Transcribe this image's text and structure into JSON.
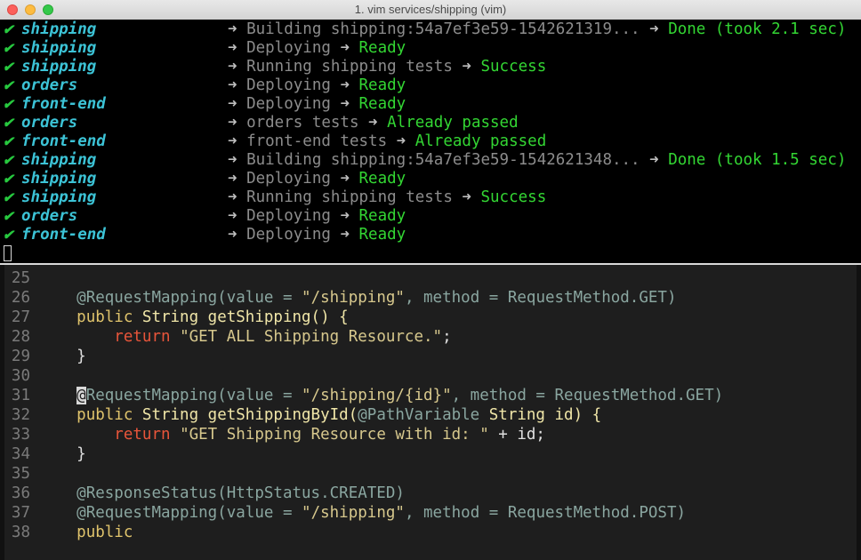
{
  "window": {
    "title": "1. vim services/shipping (vim)"
  },
  "log": {
    "check_glyph": "✔",
    "arrow_glyph": "➜",
    "lines": [
      {
        "service": "shipping",
        "action": "Building shipping:54a7ef3e59-1542621319...",
        "status": "Done (took 2.1 sec)"
      },
      {
        "service": "shipping",
        "action": "Deploying",
        "status": "Ready"
      },
      {
        "service": "shipping",
        "action": "Running shipping tests",
        "status": "Success"
      },
      {
        "service": "orders",
        "action": "Deploying",
        "status": "Ready"
      },
      {
        "service": "front-end",
        "action": "Deploying",
        "status": "Ready"
      },
      {
        "service": "orders",
        "action": "orders tests",
        "status": "Already passed"
      },
      {
        "service": "front-end",
        "action": "front-end tests",
        "status": "Already passed"
      },
      {
        "service": "shipping",
        "action": "Building shipping:54a7ef3e59-1542621348...",
        "status": "Done (took 1.5 sec)"
      },
      {
        "service": "shipping",
        "action": "Deploying",
        "status": "Ready"
      },
      {
        "service": "shipping",
        "action": "Running shipping tests",
        "status": "Success"
      },
      {
        "service": "orders",
        "action": "Deploying",
        "status": "Ready"
      },
      {
        "service": "front-end",
        "action": "Deploying",
        "status": "Ready"
      }
    ]
  },
  "editor": {
    "lines": [
      {
        "num": "25",
        "tokens": []
      },
      {
        "num": "26",
        "tokens": [
          {
            "t": "    ",
            "c": "plain"
          },
          {
            "t": "@RequestMapping(value = ",
            "c": "ann"
          },
          {
            "t": "\"/shipping\"",
            "c": "str"
          },
          {
            "t": ", method = RequestMethod.GET)",
            "c": "ann"
          }
        ]
      },
      {
        "num": "27",
        "tokens": [
          {
            "t": "    ",
            "c": "plain"
          },
          {
            "t": "public",
            "c": "kw"
          },
          {
            "t": " String getShipping() {",
            "c": "fn"
          }
        ]
      },
      {
        "num": "28",
        "tokens": [
          {
            "t": "        ",
            "c": "plain"
          },
          {
            "t": "return",
            "c": "ret"
          },
          {
            "t": " ",
            "c": "plain"
          },
          {
            "t": "\"GET ALL Shipping Resource.\"",
            "c": "str"
          },
          {
            "t": ";",
            "c": "plain"
          }
        ]
      },
      {
        "num": "29",
        "tokens": [
          {
            "t": "    }",
            "c": "plain"
          }
        ]
      },
      {
        "num": "30",
        "tokens": []
      },
      {
        "num": "31",
        "tokens": [
          {
            "t": "    ",
            "c": "plain"
          },
          {
            "t": "@",
            "c": "cursor"
          },
          {
            "t": "RequestMapping(value = ",
            "c": "ann"
          },
          {
            "t": "\"/shipping/{id}\"",
            "c": "str"
          },
          {
            "t": ", method = RequestMethod.GET)",
            "c": "ann"
          }
        ]
      },
      {
        "num": "32",
        "tokens": [
          {
            "t": "    ",
            "c": "plain"
          },
          {
            "t": "public",
            "c": "kw"
          },
          {
            "t": " String getShippingById(",
            "c": "fn"
          },
          {
            "t": "@PathVariable",
            "c": "ann"
          },
          {
            "t": " String id) {",
            "c": "fn"
          }
        ]
      },
      {
        "num": "33",
        "tokens": [
          {
            "t": "        ",
            "c": "plain"
          },
          {
            "t": "return",
            "c": "ret"
          },
          {
            "t": " ",
            "c": "plain"
          },
          {
            "t": "\"GET Shipping Resource with id: \"",
            "c": "str"
          },
          {
            "t": " + id;",
            "c": "plain"
          }
        ]
      },
      {
        "num": "34",
        "tokens": [
          {
            "t": "    }",
            "c": "plain"
          }
        ]
      },
      {
        "num": "35",
        "tokens": []
      },
      {
        "num": "36",
        "tokens": [
          {
            "t": "    ",
            "c": "plain"
          },
          {
            "t": "@ResponseStatus(HttpStatus.CREATED)",
            "c": "ann"
          }
        ]
      },
      {
        "num": "37",
        "tokens": [
          {
            "t": "    ",
            "c": "plain"
          },
          {
            "t": "@RequestMapping(value = ",
            "c": "ann"
          },
          {
            "t": "\"/shipping\"",
            "c": "str"
          },
          {
            "t": ", method = RequestMethod.POST)",
            "c": "ann"
          }
        ]
      },
      {
        "num": "38",
        "tokens": [
          {
            "t": "    ",
            "c": "plain"
          },
          {
            "t": "public",
            "c": "kw"
          }
        ]
      }
    ]
  },
  "colors": {
    "check": "#27c93f",
    "service": "#3cc3d6",
    "status": "#33d633",
    "action": "#8c8c8c",
    "annotation": "#8aa6a0",
    "string": "#d7c88d",
    "keyword": "#e0c46c",
    "return": "#e8553a"
  }
}
